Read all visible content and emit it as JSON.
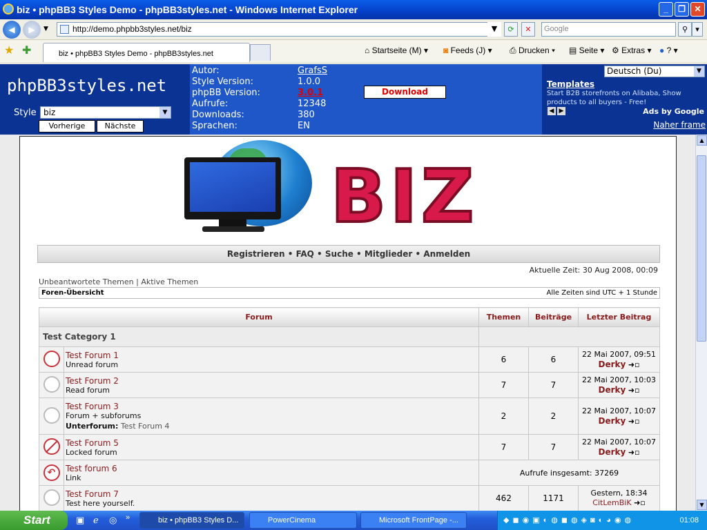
{
  "window": {
    "title": "biz • phpBB3 Styles Demo - phpBB3styles.net - Windows Internet Explorer"
  },
  "toolbar": {
    "address": "http://demo.phpbb3styles.net/biz",
    "search_placeholder": "Google",
    "tab_title": "biz • phpBB3 Styles Demo - phpBB3styles.net",
    "home": "Startseite (M)",
    "feeds": "Feeds (J)",
    "print": "Drucken",
    "page": "Seite",
    "tools": "Extras",
    "help": "?"
  },
  "header": {
    "logo": "phpBB3styles.net",
    "style_label": "Style",
    "style_value": "biz",
    "prev": "Vorherige",
    "next": "Nächste",
    "info": [
      {
        "k": "Autor:",
        "v": "GrafsS"
      },
      {
        "k": "Style Version:",
        "v": "1.0.0"
      },
      {
        "k": "phpBB Version:",
        "v": "3.0.1"
      },
      {
        "k": "Aufrufe:",
        "v": "12348"
      },
      {
        "k": "Downloads:",
        "v": "380"
      },
      {
        "k": "Sprachen:",
        "v": "EN"
      }
    ],
    "download": "Download",
    "language": "Deutsch (Du)",
    "ad_title": "Templates",
    "ad_text": "Start B2B storefronts on Alibaba, Show products to all buyers - Free!",
    "ads_by": "Ads by Google",
    "next_frame": "Naher frame"
  },
  "forum": {
    "nav": "Registrieren • FAQ • Suche • Mitglieder • Anmelden",
    "time": "Aktuelle Zeit: 30 Aug 2008, 00:09",
    "links": "Unbeantwortete Themen | Aktive Themen",
    "breadcrumb": "Foren-Übersicht",
    "timezone": "Alle Zeiten sind UTC + 1 Stunde",
    "cols": {
      "forum": "Forum",
      "topics": "Themen",
      "posts": "Beiträge",
      "last": "Letzter Beitrag"
    },
    "category": "Test Category 1",
    "rows": [
      {
        "name": "Test Forum 1",
        "desc": "Unread forum",
        "topics": "6",
        "posts": "6",
        "date": "22 Mai 2007, 09:51",
        "user": "Derky"
      },
      {
        "name": "Test Forum 2",
        "desc": "Read forum",
        "topics": "7",
        "posts": "7",
        "date": "22 Mai 2007, 10:03",
        "user": "Derky"
      },
      {
        "name": "Test Forum 3",
        "desc": "Forum + subforums",
        "sub_label": "Unterforum:",
        "sub": "Test Forum 4",
        "topics": "2",
        "posts": "2",
        "date": "22 Mai 2007, 10:07",
        "user": "Derky"
      },
      {
        "name": "Test Forum 5",
        "desc": "Locked forum",
        "topics": "7",
        "posts": "7",
        "date": "22 Mai 2007, 10:07",
        "user": "Derky"
      },
      {
        "name": "Test forum 6",
        "desc": "Link",
        "redirects": "Aufrufe insgesamt: 37269"
      },
      {
        "name": "Test Forum 7",
        "desc": "Test here yourself.",
        "topics": "462",
        "posts": "1171",
        "date": "Gestern, 18:34",
        "user": "CitLemBiK"
      }
    ]
  },
  "taskbar": {
    "start": "Start",
    "tasks": [
      "biz • phpBB3 Styles D...",
      "PowerCinema",
      "Microsoft FrontPage -..."
    ],
    "clock": "01:08"
  }
}
